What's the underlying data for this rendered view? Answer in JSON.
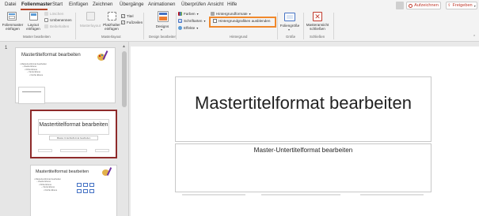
{
  "menu": {
    "items": [
      "Datei",
      "Folienmaster",
      "Start",
      "Einfügen",
      "Zeichnen",
      "Übergänge",
      "Animationen",
      "Überprüfen",
      "Ansicht",
      "Hilfe"
    ],
    "active": "Folienmaster",
    "record_label": "Aufzeichnen",
    "share_label": "Freigeben"
  },
  "ribbon": {
    "insert_master": "Folienmaster einfügen",
    "insert_layout": "Layout einfügen",
    "delete": "Löschen",
    "rename": "Umbenennen",
    "preserve": "Beibehalten",
    "group_master": "Master bearbeiten",
    "master_layout": "Masterlayout",
    "insert_placeholder": "Platzhalter einfügen",
    "title_check": "Titel",
    "footer_check": "Fußzeilen",
    "group_layout": "Masterlayout",
    "designs": "Designs",
    "group_design": "Design bearbeiten",
    "colors": "Farben",
    "fonts": "Schriftarten",
    "effects": "Effekte",
    "background_styles": "Hintergrundformate",
    "hide_background": "Hintergrundgrafiken ausblenden",
    "group_background": "Hintergrund",
    "slide_size": "Foliengröße",
    "group_size": "Größe",
    "close_master": "Masteransicht schließen",
    "group_close": "Schließen"
  },
  "thumbnails": {
    "slide_number": "1",
    "master_title": "Mastertitelformat bearbeiten",
    "master_lines": [
      "• Mastertextformat bearbeiten",
      "  – Zweite Ebene",
      "    • Dritte Ebene",
      "      – Vierte Ebene",
      "        • Fünfte Ebene"
    ],
    "layout_title": "Mastertitelformat bearbeiten",
    "layout_sub": "Master-Untertitelformat bearbeiten",
    "layout3_title": "Mastertitelformat bearbeiten",
    "layout3_lines": [
      "• Mastertextformat bearbeiten",
      "  – Zweite Ebene",
      "    • Dritte Ebene",
      "      – Vierte Ebene",
      "        • Fünfte Ebene"
    ]
  },
  "slide": {
    "title": "Mastertitelformat bearbeiten",
    "subtitle": "Master-Untertitelformat bearbeiten"
  },
  "colors": {
    "accent": "#b7472a",
    "highlight": "#f0882b",
    "selected_thumb": "#8e2a2a"
  }
}
